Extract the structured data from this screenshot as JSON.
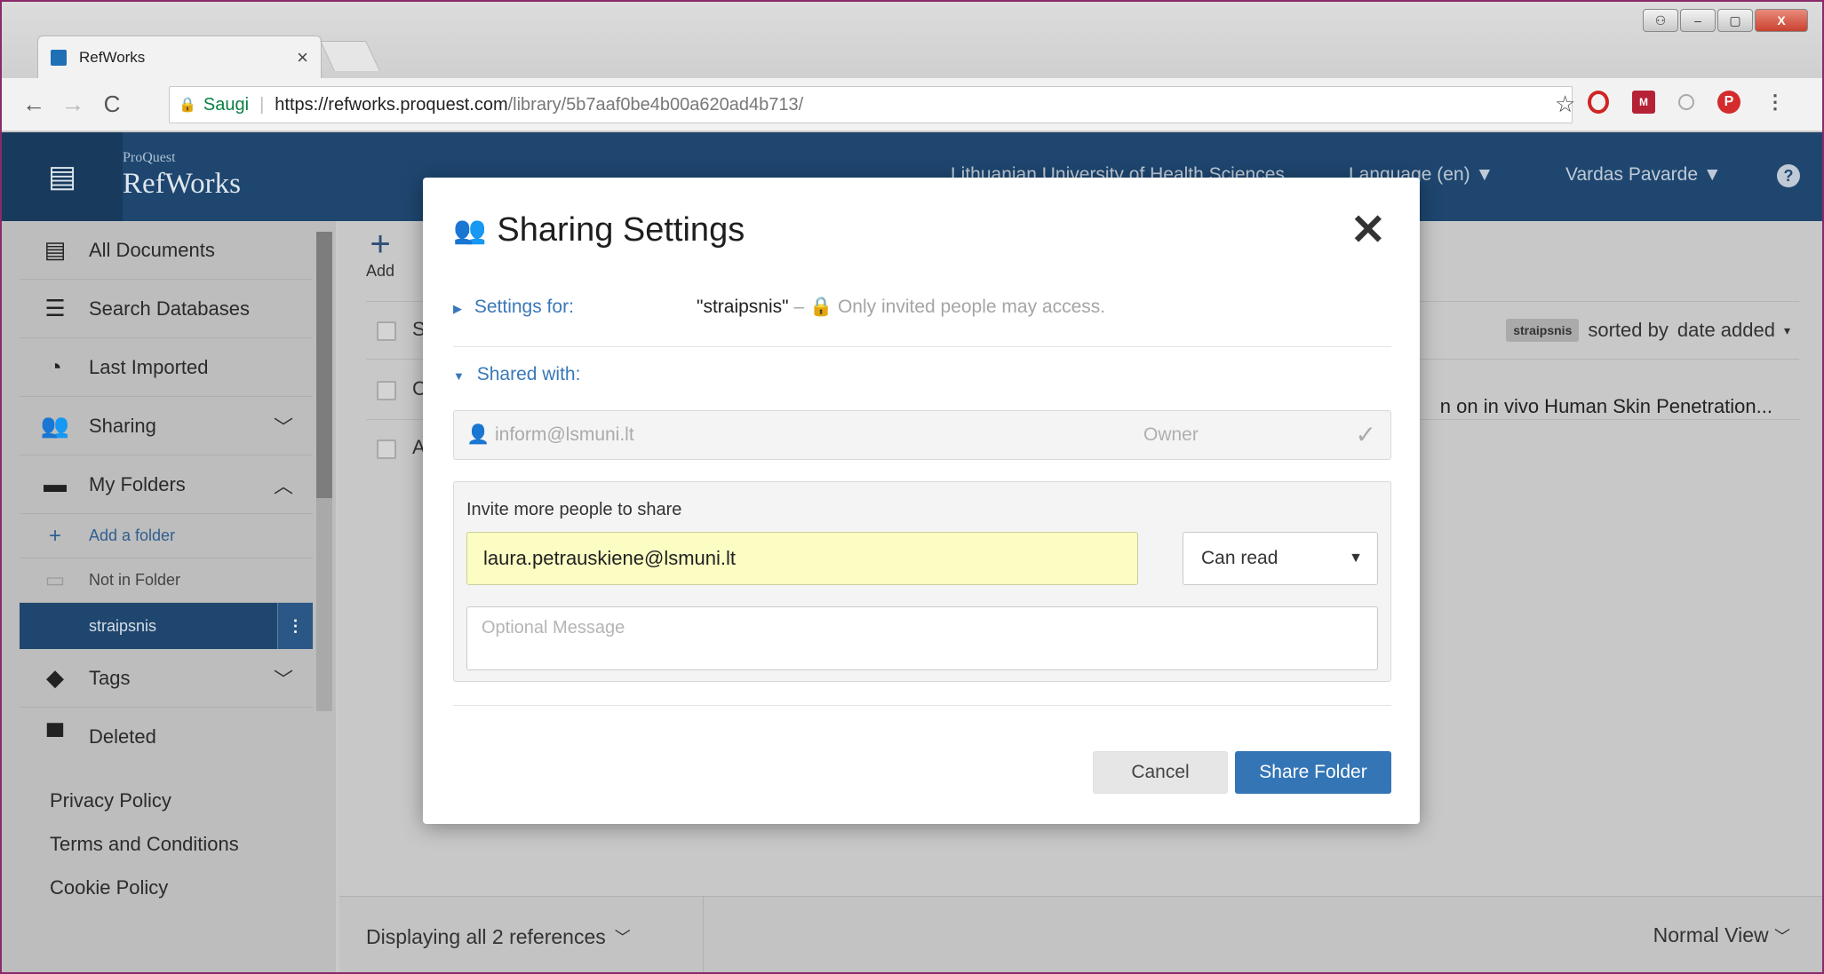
{
  "browser": {
    "tab_title": "RefWorks",
    "tab_close": "×",
    "secure_label": "Saugi",
    "url_host": "https://refworks.proquest.com",
    "url_path": "/library/5b7aaf0be4b00a620ad4b713/",
    "star": "☆",
    "back": "←",
    "forward": "→",
    "reload": "C"
  },
  "header": {
    "brand_small": "ProQuest",
    "brand": "RefWorks",
    "institution": "Lithuanian University of Health Sciences",
    "language": "Language (en) ▼",
    "user": "Vardas Pavarde ▼",
    "help": "?"
  },
  "sidebar": {
    "items": [
      {
        "label": "All Documents",
        "icon": "document-icon"
      },
      {
        "label": "Search Databases",
        "icon": "database-icon"
      },
      {
        "label": "Last Imported",
        "icon": "clock-icon"
      },
      {
        "label": "Sharing",
        "icon": "people-icon"
      },
      {
        "label": "My Folders",
        "icon": "folder-icon"
      }
    ],
    "add_folder": "Add a folder",
    "not_in_folder": "Not in Folder",
    "selected_folder": "straipsnis",
    "tags": "Tags",
    "deleted": "Deleted",
    "footer_links": [
      "Privacy Policy",
      "Terms and Conditions",
      "Cookie Policy"
    ]
  },
  "main": {
    "add_label": "Add",
    "row1_initial": "S",
    "row2_initial": "C",
    "row3_initial": "A",
    "sort_pill": "straipsnis",
    "sort_text": "sorted by",
    "sort_value": "date added",
    "ref_title": "n on in vivo Human Skin Penetration...",
    "displaying": "Displaying all 2 references",
    "view": "Normal View"
  },
  "modal": {
    "title": "Sharing Settings",
    "close": "✕",
    "settings_for_label": "Settings for:",
    "settings_folder": "\"straipsnis\"",
    "settings_dash": " – ",
    "settings_access": "Only invited people may access.",
    "shared_with_label": "Shared with:",
    "owner_email": "inform@lsmuni.lt",
    "owner_role": "Owner",
    "invite_label": "Invite more people to share",
    "invite_email_value": "laura.petrauskiene@lsmuni.lt",
    "permission": "Can read",
    "message_placeholder": "Optional Message",
    "cancel": "Cancel",
    "share": "Share Folder"
  },
  "colors": {
    "header_bg": "#1e466f",
    "primary_button": "#3475b5",
    "link": "#3878b8",
    "invite_input_bg": "#fbfdc2"
  }
}
